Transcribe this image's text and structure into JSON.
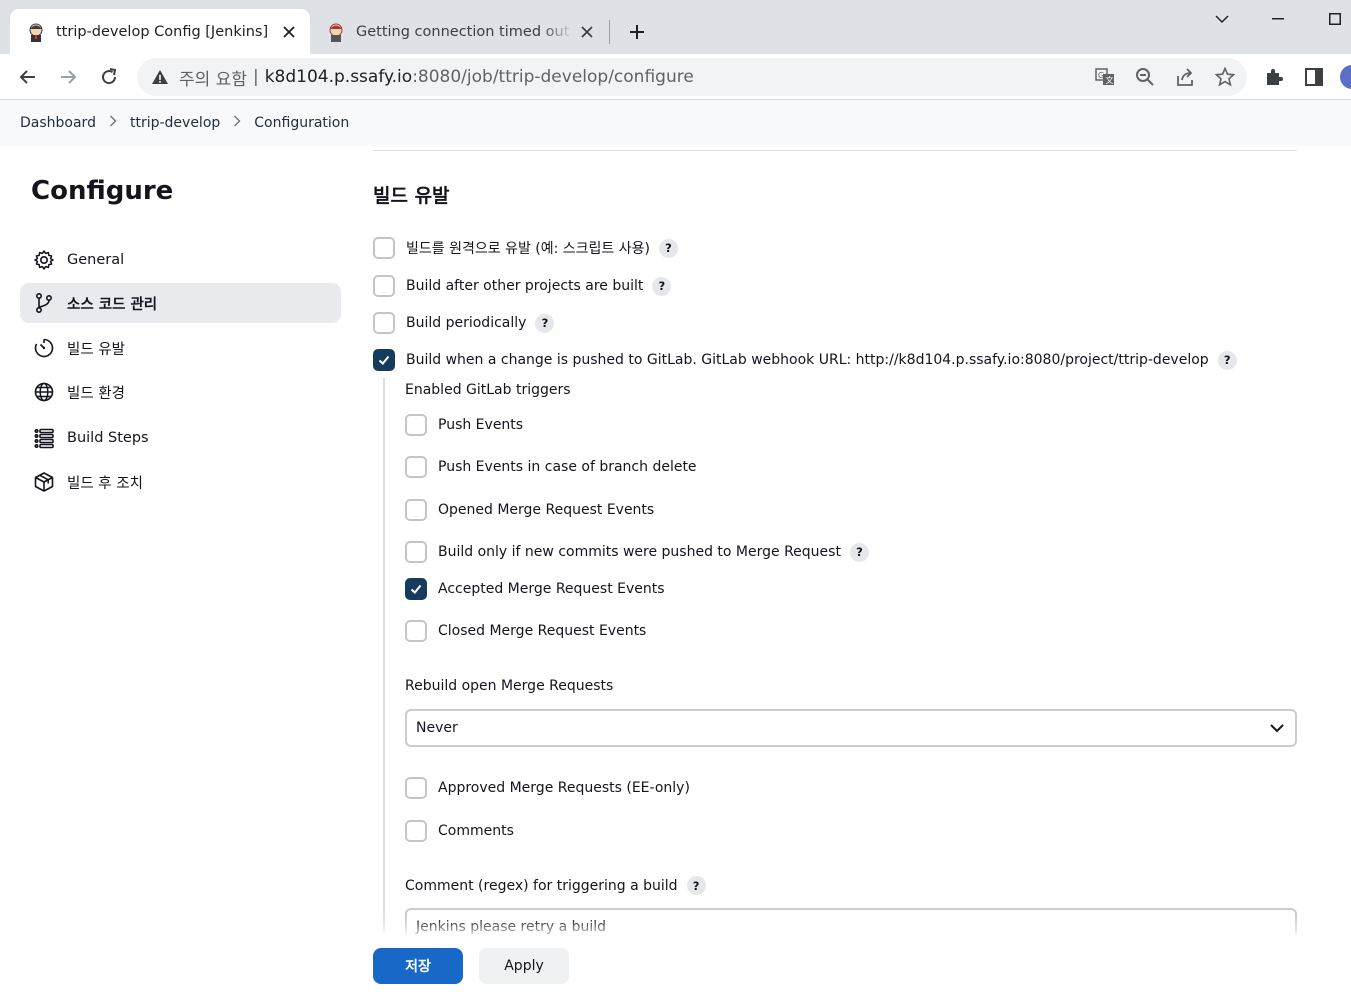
{
  "browser": {
    "tabs": [
      {
        "title": "ttrip-develop Config [Jenkins]",
        "favicon": "jenkins-butler-icon",
        "active": true
      },
      {
        "title": "Getting connection timed out w",
        "favicon": "gitlab-icon",
        "active": false
      }
    ],
    "address": {
      "security": "주의 요함",
      "separator": "|",
      "host": "k8d104.p.ssafy.io",
      "path": ":8080/job/ttrip-develop/configure"
    }
  },
  "breadcrumb": [
    "Dashboard",
    "ttrip-develop",
    "Configuration"
  ],
  "sidebar": {
    "title": "Configure",
    "items": [
      {
        "label": "General",
        "icon": "gear-icon",
        "active": false
      },
      {
        "label": "소스 코드 관리",
        "icon": "source-branch-icon",
        "active": true
      },
      {
        "label": "빌드 유발",
        "icon": "timer-icon",
        "active": false
      },
      {
        "label": "빌드 환경",
        "icon": "globe-icon",
        "active": false
      },
      {
        "label": "Build Steps",
        "icon": "list-icon",
        "active": false
      },
      {
        "label": "빌드 후 조치",
        "icon": "package-icon",
        "active": false
      }
    ]
  },
  "section": {
    "title": "빌드 유발",
    "triggers": [
      {
        "label": "빌드를 원격으로 유발 (예: 스크립트 사용)",
        "checked": false,
        "help": "?"
      },
      {
        "label": "Build after other projects are built",
        "checked": false,
        "help": "?"
      },
      {
        "label": "Build periodically",
        "checked": false,
        "help": "?"
      },
      {
        "label": "Build when a change is pushed to GitLab. GitLab webhook URL: http://k8d104.p.ssafy.io:8080/project/ttrip-develop",
        "checked": true,
        "help": "?"
      }
    ],
    "gitlab": {
      "enabled_label": "Enabled GitLab triggers",
      "events": [
        {
          "label": "Push Events",
          "checked": false
        },
        {
          "label": "Push Events in case of branch delete",
          "checked": false
        },
        {
          "label": "Opened Merge Request Events",
          "checked": false
        },
        {
          "label": "Build only if new commits were pushed to Merge Request",
          "checked": false,
          "help": "?"
        },
        {
          "label": "Accepted Merge Request Events",
          "checked": true
        },
        {
          "label": "Closed Merge Request Events",
          "checked": false
        }
      ],
      "rebuild_label": "Rebuild open Merge Requests",
      "rebuild_value": "Never",
      "extra": [
        {
          "label": "Approved Merge Requests (EE-only)",
          "checked": false
        },
        {
          "label": "Comments",
          "checked": false
        }
      ],
      "comment_label": "Comment (regex) for triggering a build",
      "comment_help": "?",
      "comment_value": "Jenkins please retry a build"
    }
  },
  "actions": {
    "save": "저장",
    "apply": "Apply"
  },
  "colors": {
    "checkbox_checked": "#153c5f",
    "save_button": "#1868c7",
    "sidebar_active": "#e9eaee"
  }
}
